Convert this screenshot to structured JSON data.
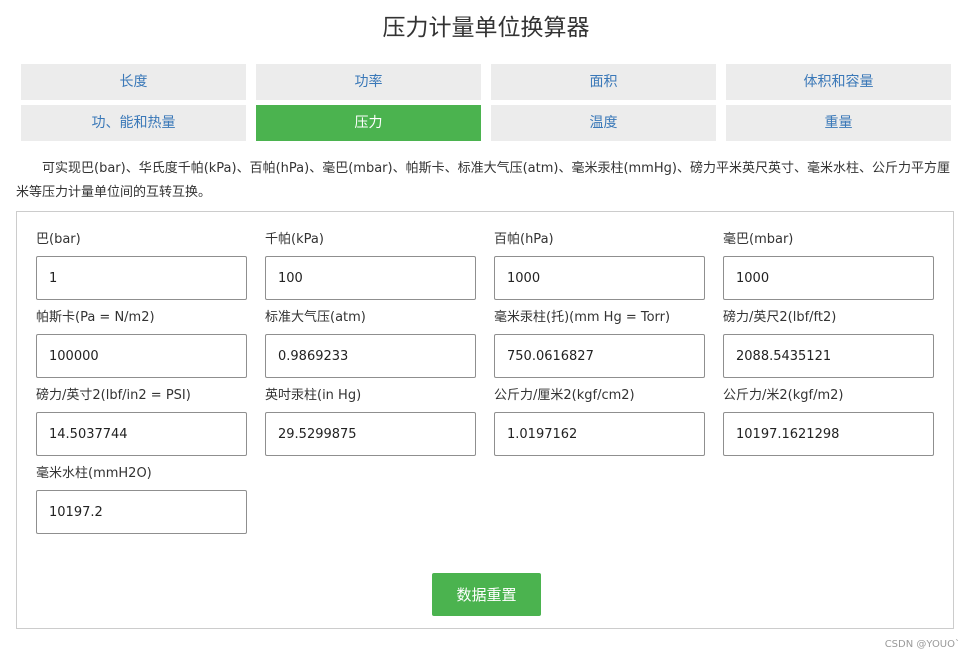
{
  "title": "压力计量单位换算器",
  "tabs": [
    {
      "label": "长度",
      "active": false
    },
    {
      "label": "功率",
      "active": false
    },
    {
      "label": "面积",
      "active": false
    },
    {
      "label": "体积和容量",
      "active": false
    },
    {
      "label": "功、能和热量",
      "active": false
    },
    {
      "label": "压力",
      "active": true
    },
    {
      "label": "温度",
      "active": false
    },
    {
      "label": "重量",
      "active": false
    }
  ],
  "description": "可实现巴(bar)、华氏度千帕(kPa)、百帕(hPa)、毫巴(mbar)、帕斯卡、标准大气压(atm)、毫米汞柱(mmHg)、磅力平米英尺英寸、毫米水柱、公斤力平方厘米等压力计量单位间的互转互换。",
  "fields": [
    {
      "label": "巴(bar)",
      "value": "1"
    },
    {
      "label": "千帕(kPa)",
      "value": "100"
    },
    {
      "label": "百帕(hPa)",
      "value": "1000"
    },
    {
      "label": "毫巴(mbar)",
      "value": "1000"
    },
    {
      "label": "帕斯卡(Pa = N/m2)",
      "value": "100000"
    },
    {
      "label": "标准大气压(atm)",
      "value": "0.9869233"
    },
    {
      "label": "毫米汞柱(托)(mm Hg = Torr)",
      "value": "750.0616827"
    },
    {
      "label": "磅力/英尺2(lbf/ft2)",
      "value": "2088.5435121"
    },
    {
      "label": "磅力/英寸2(lbf/in2 = PSI)",
      "value": "14.5037744"
    },
    {
      "label": "英吋汞柱(in Hg)",
      "value": "29.5299875"
    },
    {
      "label": "公斤力/厘米2(kgf/cm2)",
      "value": "1.0197162"
    },
    {
      "label": "公斤力/米2(kgf/m2)",
      "value": "10197.1621298"
    },
    {
      "label": "毫米水柱(mmH2O)",
      "value": "10197.2"
    }
  ],
  "reset_label": "数据重置",
  "watermark": "CSDN @YOUO`",
  "colors": {
    "accent": "#4bb34f",
    "tab_bg": "#ececec",
    "tab_text": "#3a78b8"
  }
}
